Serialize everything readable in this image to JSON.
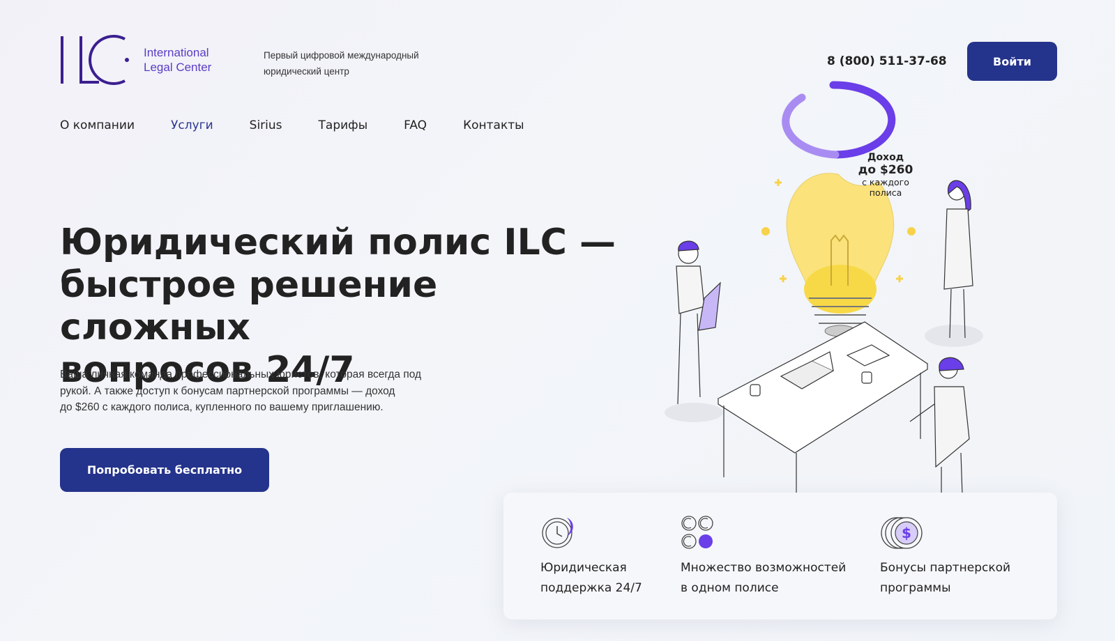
{
  "brand": {
    "logo_letters": "ILC",
    "name_line1": "International",
    "name_line2": "Legal Center",
    "tagline_line1": "Первый цифровой международный",
    "tagline_line2": "юридический центр"
  },
  "header": {
    "phone": "8 (800) 511-37-68",
    "login_label": "Войти"
  },
  "nav": {
    "items": [
      {
        "label": "О компании"
      },
      {
        "label": "Услуги"
      },
      {
        "label": "Sirius"
      },
      {
        "label": "Тарифы"
      },
      {
        "label": "FAQ"
      },
      {
        "label": "Контакты"
      }
    ],
    "active": "Услуги"
  },
  "hero": {
    "title_line1": "Юридический полис ILC —",
    "title_line2": "быстрое решение сложных",
    "title_line3": "вопросов 24/7",
    "desc_line1": "Ваша личная команда профессиональных юристов, которая всегда под",
    "desc_line2": "рукой. А также доступ к бонусам партнерской программы — доход",
    "desc_line3": "до $260 с каждого полиса, купленного по вашему приглашению.",
    "cta_label": "Попробовать бесплатно"
  },
  "income_badge": {
    "line1": "Доход",
    "line2": "до $260",
    "line3": "с каждого",
    "line4": "полиса"
  },
  "features": [
    {
      "icon": "clock-icon",
      "label": "Юридическая\nподдержка 24/7"
    },
    {
      "icon": "options-grid-icon",
      "label": "Множество возможностей\nв одном полисе"
    },
    {
      "icon": "dollar-coin-icon",
      "label": "Бонусы партнерской\nпрограммы"
    }
  ],
  "colors": {
    "primary": "#24338b",
    "accent": "#6a3ee8",
    "bulb": "#fbe27a"
  }
}
